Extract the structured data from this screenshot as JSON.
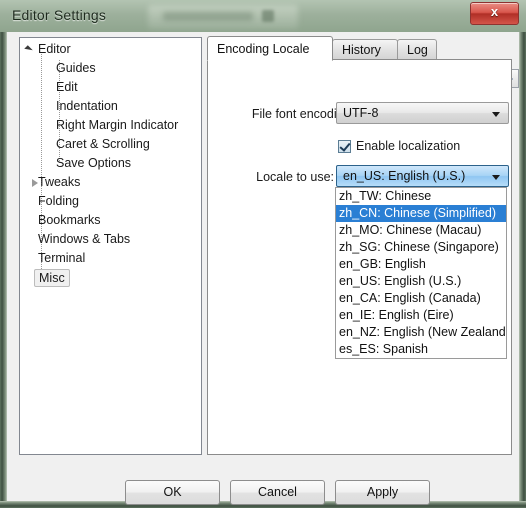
{
  "window": {
    "title": "Editor Settings",
    "close_label": "x",
    "accent_selection": "#2a7fd4",
    "close_button_color": "#c0392b",
    "frame_color": "#8fa58e"
  },
  "tree": {
    "items": [
      {
        "label": "Editor",
        "level": 0,
        "expander": "expanded",
        "selected": false
      },
      {
        "label": "Guides",
        "level": 1,
        "expander": "none",
        "selected": false
      },
      {
        "label": "Edit",
        "level": 1,
        "expander": "none",
        "selected": false
      },
      {
        "label": "Indentation",
        "level": 1,
        "expander": "none",
        "selected": false
      },
      {
        "label": "Right Margin Indicator",
        "level": 1,
        "expander": "none",
        "selected": false
      },
      {
        "label": "Caret & Scrolling",
        "level": 1,
        "expander": "none",
        "selected": false
      },
      {
        "label": "Save Options",
        "level": 1,
        "expander": "none",
        "selected": false
      },
      {
        "label": "Tweaks",
        "level": 0,
        "expander": "collapsed",
        "selected": false
      },
      {
        "label": "Folding",
        "level": 0,
        "expander": "none",
        "selected": false
      },
      {
        "label": "Bookmarks",
        "level": 0,
        "expander": "none",
        "selected": false
      },
      {
        "label": "Windows & Tabs",
        "level": 0,
        "expander": "none",
        "selected": false
      },
      {
        "label": "Terminal",
        "level": 0,
        "expander": "none",
        "selected": false
      },
      {
        "label": "Misc",
        "level": 0,
        "expander": "none",
        "selected": true
      }
    ]
  },
  "tabs": {
    "items": [
      {
        "label": "Encoding  Locale",
        "active": true
      },
      {
        "label": "History",
        "active": false
      },
      {
        "label": "Log",
        "active": false
      }
    ],
    "nav_prev": "◄",
    "nav_next": "►"
  },
  "form": {
    "encoding_label": "File font encoding:",
    "encoding_value": "UTF-8",
    "localization_label": "Enable localization",
    "localization_checked": true,
    "locale_label": "Locale to use:",
    "locale_value": "en_US: English (U.S.)"
  },
  "locale_dropdown": {
    "open": true,
    "options": [
      {
        "label": "zh_TW: Chinese",
        "selected": false
      },
      {
        "label": "zh_CN: Chinese (Simplified)",
        "selected": true
      },
      {
        "label": "zh_MO: Chinese (Macau)",
        "selected": false
      },
      {
        "label": "zh_SG: Chinese (Singapore)",
        "selected": false
      },
      {
        "label": "en_GB: English",
        "selected": false
      },
      {
        "label": "en_US: English (U.S.)",
        "selected": false
      },
      {
        "label": "en_CA: English (Canada)",
        "selected": false
      },
      {
        "label": "en_IE: English (Eire)",
        "selected": false
      },
      {
        "label": "en_NZ: English (New Zealand)",
        "selected": false
      },
      {
        "label": "es_ES: Spanish",
        "selected": false
      }
    ]
  },
  "buttons": {
    "ok": "OK",
    "cancel": "Cancel",
    "apply": "Apply"
  }
}
